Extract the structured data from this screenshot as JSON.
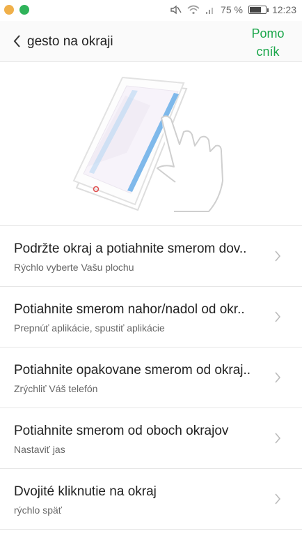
{
  "status_bar": {
    "battery_percent": "75 %",
    "battery_level": 0.75,
    "time": "12:23",
    "notification_icons": [
      "app-notification-icon",
      "hangouts-icon"
    ],
    "status_icons": [
      "mute-icon",
      "wifi-icon",
      "signal-icon",
      "battery-icon"
    ]
  },
  "header": {
    "back_icon": "chevron-left-icon",
    "title": "gesto na okraji",
    "help_label": "Pomocník"
  },
  "illustration": {
    "icon": "phone-edge-gesture-illustration",
    "accent_color": "#6aaee8"
  },
  "settings": [
    {
      "title": "Podržte okraj a potiahnite smerom dov..",
      "subtitle": "Rýchlo vyberte Vašu plochu"
    },
    {
      "title": "Potiahnite smerom nahor/nadol od okr..",
      "subtitle": "Prepnúť aplikácie, spustiť aplikácie"
    },
    {
      "title": "Potiahnite opakovane smerom od okraj..",
      "subtitle": "Zrýchliť Váš telefón"
    },
    {
      "title": "Potiahnite smerom od oboch okrajov",
      "subtitle": "Nastaviť jas"
    },
    {
      "title": "Dvojité kliknutie na okraj",
      "subtitle": "rýchlo späť"
    }
  ],
  "colors": {
    "accent_green": "#1aa64a",
    "divider": "#e6e6e6",
    "chevron": "#bbbbbb"
  }
}
